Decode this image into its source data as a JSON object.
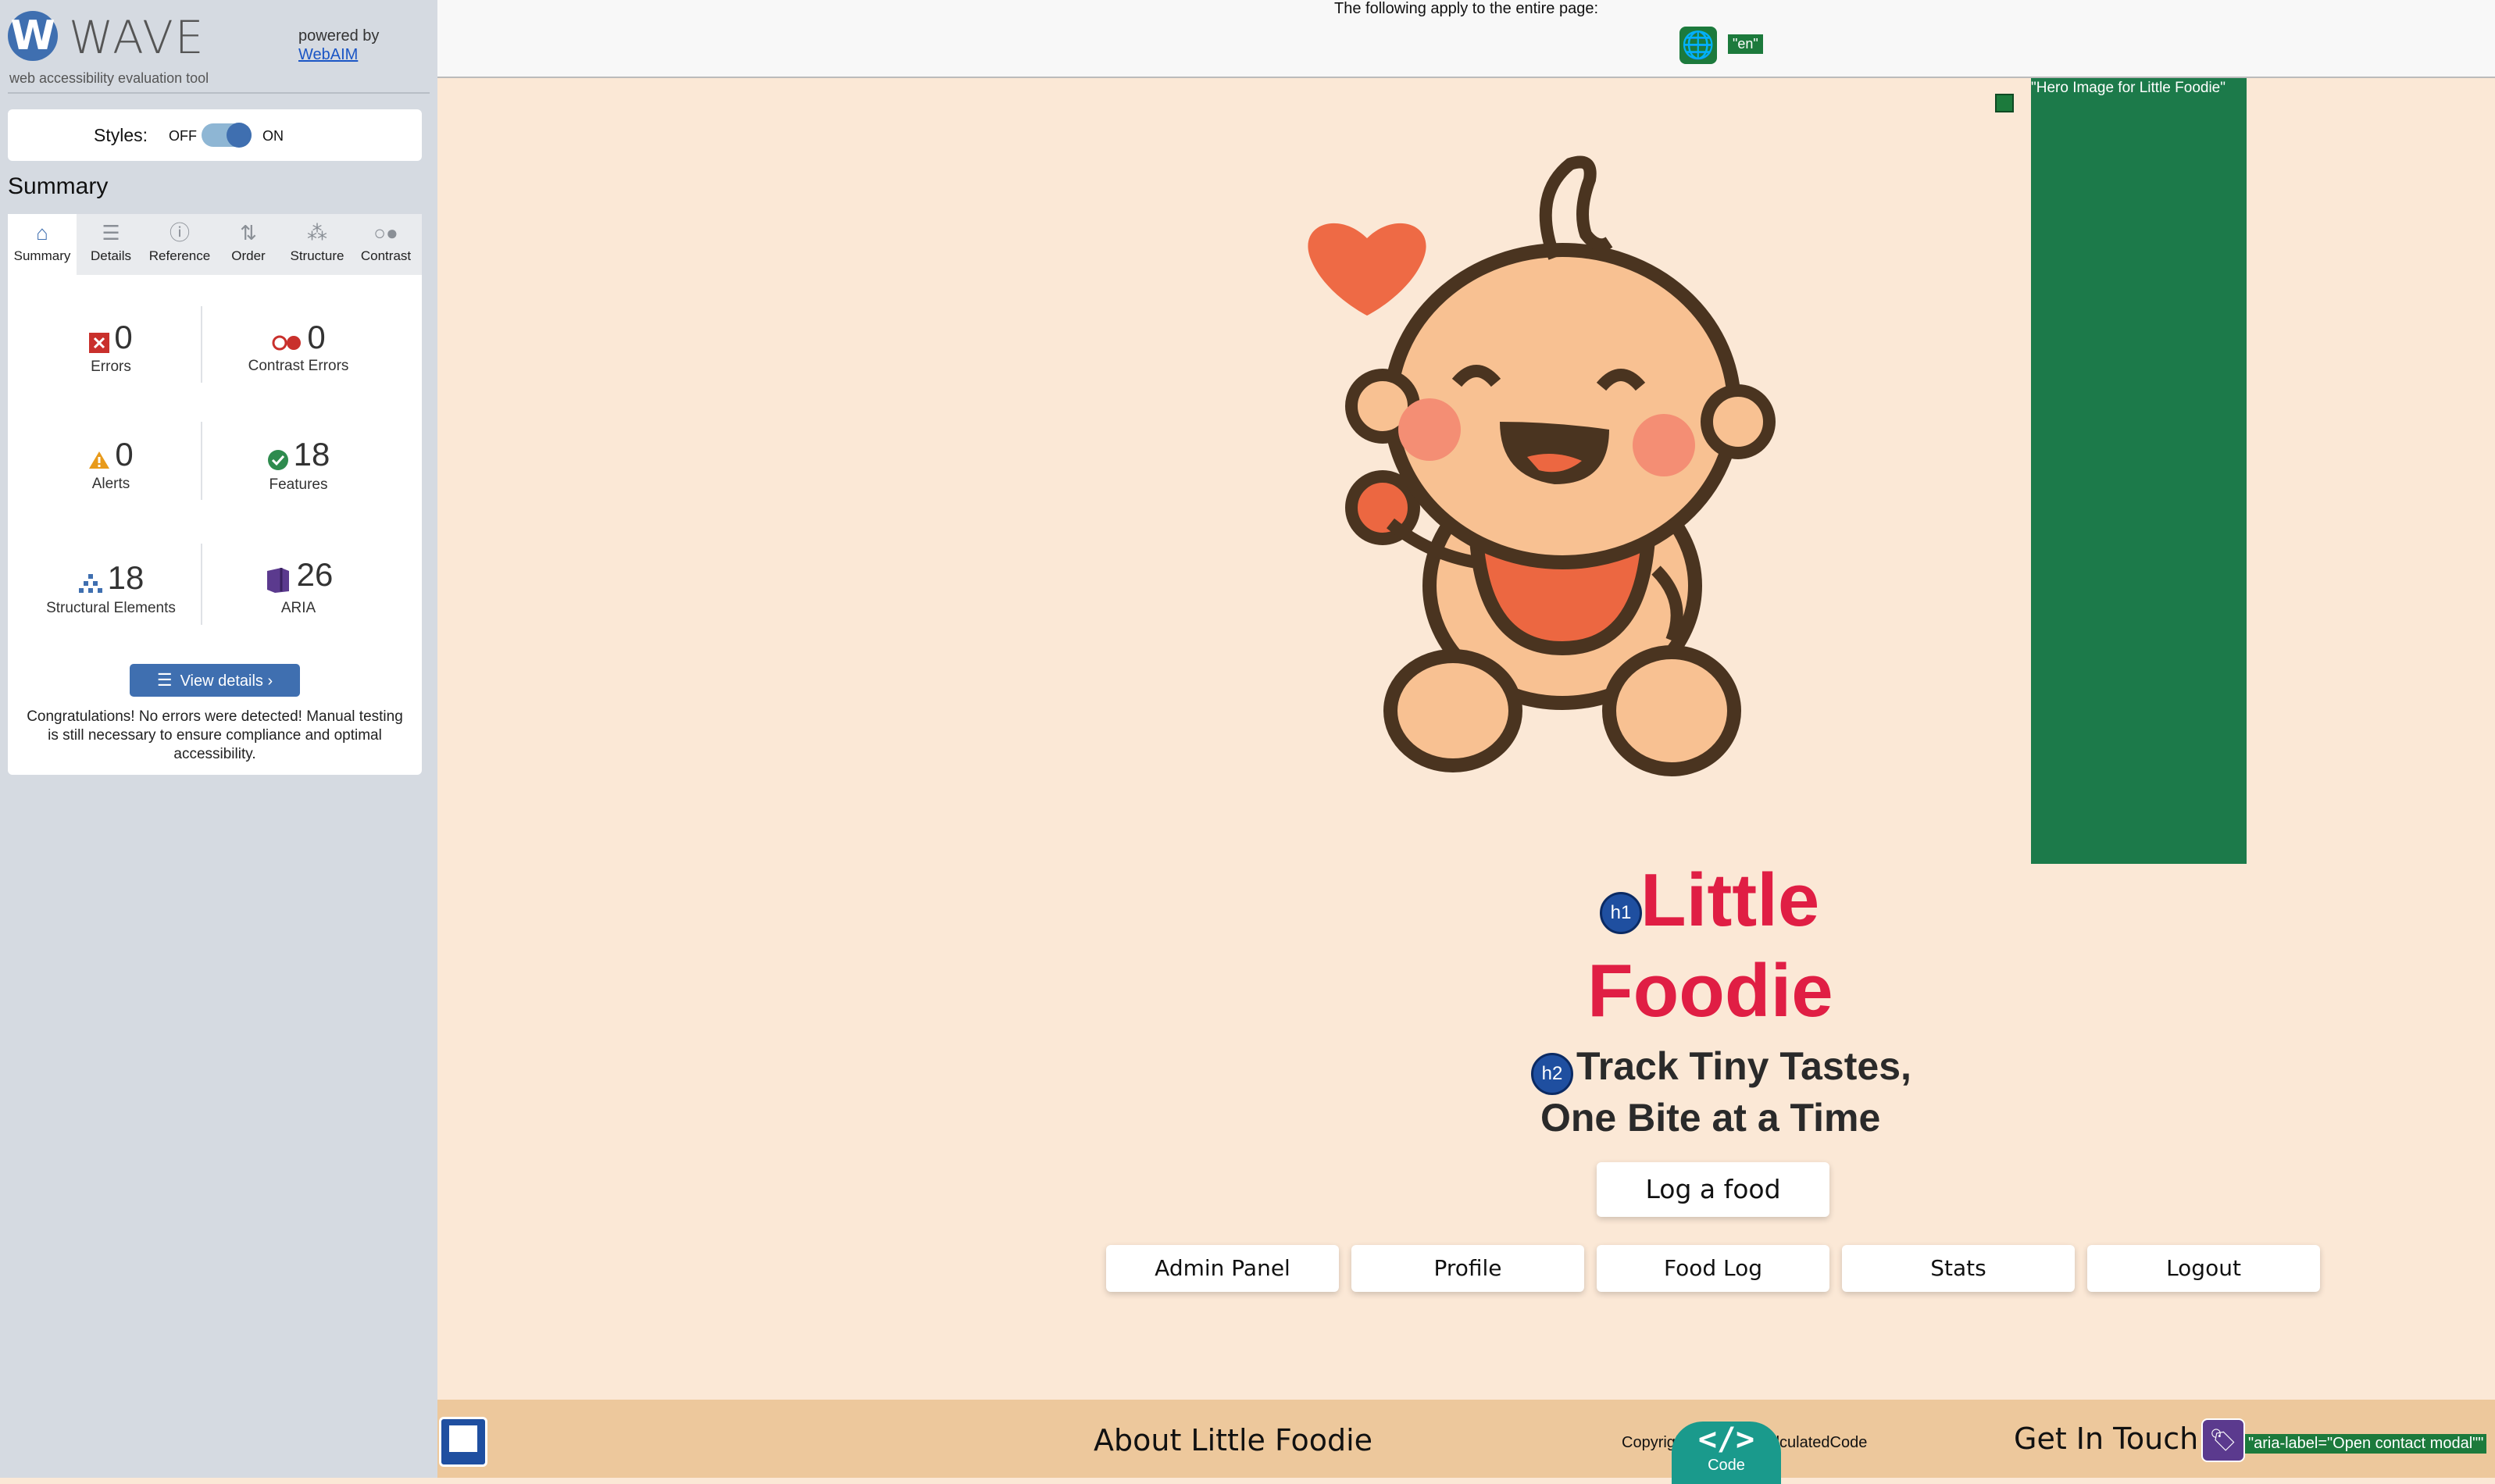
{
  "wave": {
    "logo_letter": "W",
    "title": "WAVE",
    "subtitle": "web accessibility evaluation tool",
    "powered_by": "powered by",
    "webaim": "WebAIM",
    "styles_label": "Styles:",
    "styles_off": "OFF",
    "styles_on": "ON",
    "summary_heading": "Summary",
    "tabs": [
      {
        "label": "Summary",
        "icon": "home-icon"
      },
      {
        "label": "Details",
        "icon": "list-icon"
      },
      {
        "label": "Reference",
        "icon": "info-icon"
      },
      {
        "label": "Order",
        "icon": "order-icon"
      },
      {
        "label": "Structure",
        "icon": "structure-icon"
      },
      {
        "label": "Contrast",
        "icon": "contrast-icon"
      }
    ],
    "stats": {
      "errors": {
        "value": "0",
        "label": "Errors"
      },
      "contrast_errors": {
        "value": "0",
        "label": "Contrast Errors"
      },
      "alerts": {
        "value": "0",
        "label": "Alerts"
      },
      "features": {
        "value": "18",
        "label": "Features"
      },
      "structural": {
        "value": "18",
        "label": "Structural Elements"
      },
      "aria": {
        "value": "26",
        "label": "ARIA"
      }
    },
    "view_details": "View details ›",
    "congrats": "Congratulations! No errors were detected! Manual testing is still necessary to ensure compliance and optimal accessibility."
  },
  "topbar": {
    "apply_text": "The following apply to the entire page:",
    "lang_tag": "\"en\""
  },
  "hero": {
    "image_label": "\"Hero Image for Little Foodie\""
  },
  "page": {
    "h1_badge": "h1",
    "h2_badge": "h2",
    "title_line1": "Little",
    "title_line2": "Foodie",
    "subtitle_line1": "Track Tiny Tastes,",
    "subtitle_line2": "One Bite at a Time",
    "log_button": "Log a food",
    "nav": [
      "Admin Panel",
      "Profile",
      "Food Log",
      "Stats",
      "Logout"
    ]
  },
  "footer": {
    "about": "About Little Foodie",
    "copyright": "Copyright",
    "copyright_rest": "lculatedCode",
    "code_glyph": "</>",
    "code_label": "Code",
    "get_in_touch": "Get In Touch",
    "aria_label": "\"aria-label=\"Open contact modal\"\""
  },
  "colors": {
    "brand_blue": "#3f6fb0",
    "wave_green": "#1c7a3c",
    "title_red": "#e01e44",
    "page_bg": "#fbe8d6",
    "footer_bg": "#edc89c"
  }
}
